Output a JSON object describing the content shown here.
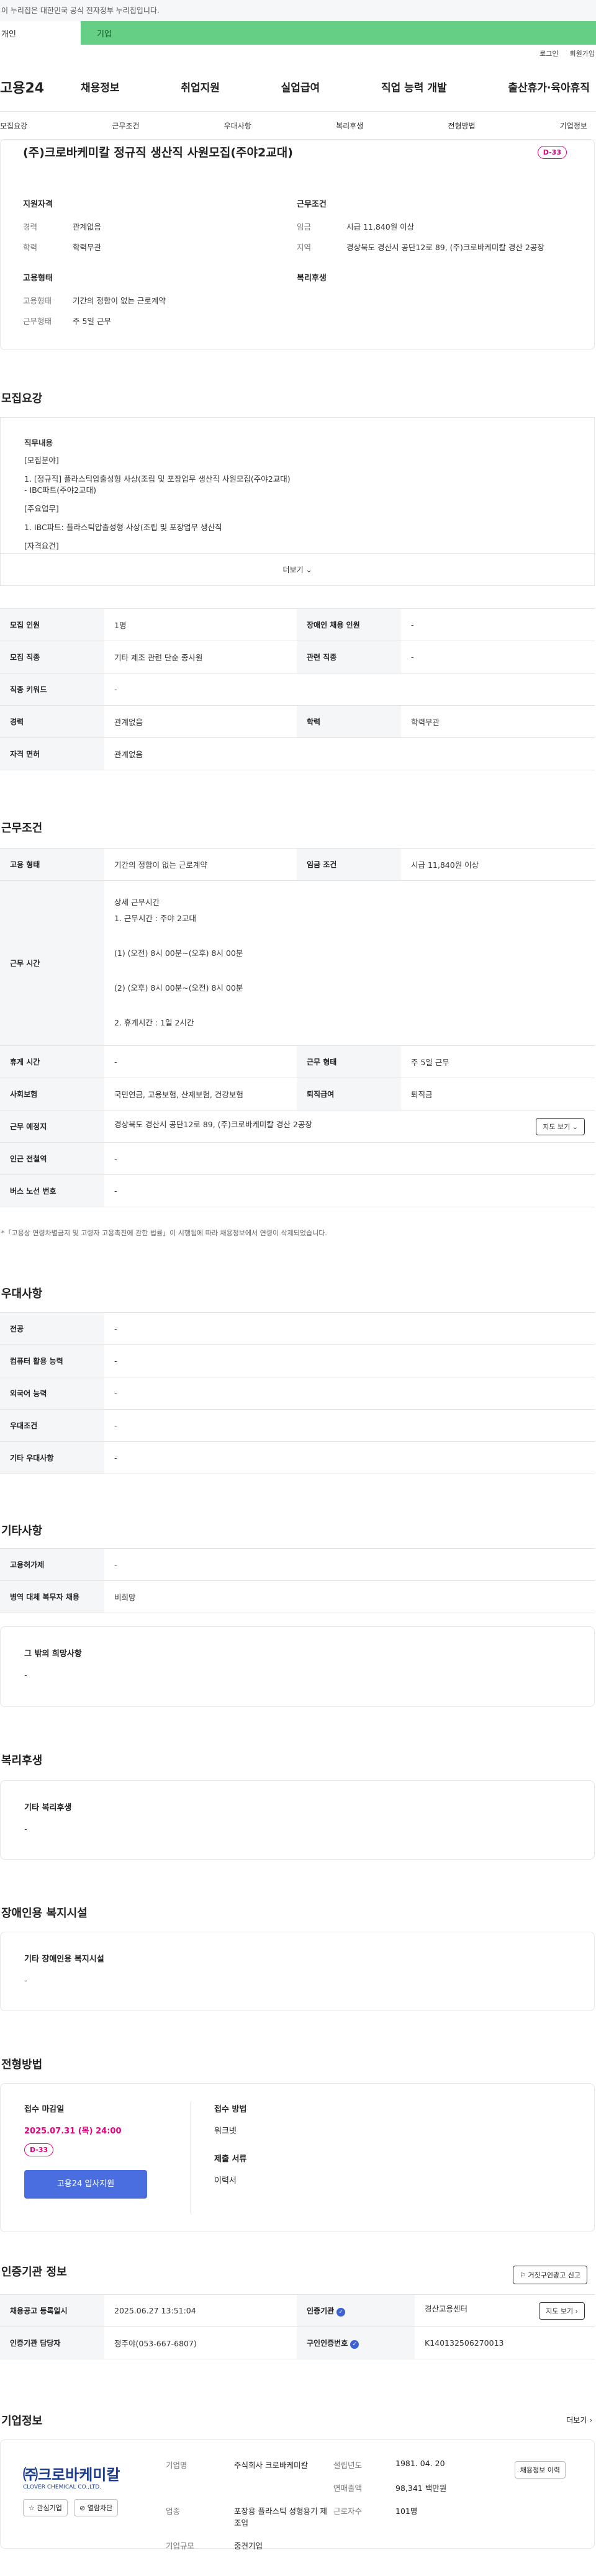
{
  "top_notice": "이 누리집은 대한민국 공식 전자정부 누리집입니다.",
  "tabs": {
    "personal": "개인",
    "company": "기업"
  },
  "util": {
    "login": "로그인",
    "join": "회원가입"
  },
  "gnb": {
    "logo": "고용24",
    "menu": [
      "채용정보",
      "취업지원",
      "실업급여",
      "직업 능력 개발",
      "출산휴가·육아휴직"
    ]
  },
  "anchors": [
    "모집요강",
    "근무조건",
    "우대사항",
    "복리후생",
    "전형방법",
    "기업정보"
  ],
  "summary": {
    "title": "(주)크로바케미칼 정규직 생산직 사원모집(주야2교대)",
    "dday": "D-33",
    "support": {
      "heading": "지원자격",
      "career_k": "경력",
      "career_v": "관계없음",
      "edu_k": "학력",
      "edu_v": "학력무관"
    },
    "conditions": {
      "heading": "근무조건",
      "wage_k": "임금",
      "wage_v": "시급 11,840원 이상",
      "area_k": "지역",
      "area_v": "경상북도 경산시 공단12로 89, (주)크로바케미칼 경산 2공장"
    },
    "employment": {
      "heading": "고용형태",
      "type_k": "고용형태",
      "type_v": "기간의 정함이 없는 근로계약",
      "shape_k": "근무형태",
      "shape_v": "주 5일 근무"
    },
    "welfare_heading": "복리후생"
  },
  "recruit": {
    "title": "모집요강",
    "detail_lines": [
      "직무내용",
      "[모집분야]",
      "1. [정규직] 플라스틱압출성형 사상(조립 및 포장업무 생산직 사원모집(주야2교대)",
      "- IBC파트(주야2교대)",
      "[주요업무]",
      "1. IBC파트: 플라스틱압출성형 사상(조립 및 포장업무 생산직",
      "[자격요건]"
    ],
    "more": "더보기",
    "rows": [
      {
        "k1": "모집 인원",
        "v1": "1명",
        "k2": "장애인 채용 인원",
        "v2": "-"
      },
      {
        "k1": "모집 직종",
        "v1": "기타 제조 관련 단순 종사원",
        "k2": "관련 직종",
        "v2": "-"
      },
      {
        "k1": "직종 키워드",
        "v1": "-"
      },
      {
        "k1": "경력",
        "v1": "관계없음",
        "k2": "학력",
        "v2": "학력무관"
      },
      {
        "k1": "자격 면허",
        "v1": "관계없음"
      }
    ]
  },
  "work": {
    "title": "근무조건",
    "employ_k": "고용 형태",
    "employ_v": "기간의 정함이 없는 근로계약",
    "wage_k": "임금 조건",
    "wage_v": "시급 11,840원 이상",
    "time_k": "근무 시간",
    "time_lines": [
      "상세 근무시간",
      "1. 근무시간 : 주야 2교대",
      "(1) (오전) 8시 00분~(오후) 8시 00분",
      "(2) (오후) 8시 00분~(오전) 8시 00분",
      "2. 휴게시간 : 1일 2시간"
    ],
    "rest_k": "휴게 시간",
    "rest_v": "-",
    "shape_k": "근무 형태",
    "shape_v": "주 5일 근무",
    "ins_k": "사회보험",
    "ins_v": "국민연금, 고용보험, 산재보험, 건강보험",
    "sev_k": "퇴직급여",
    "sev_v": "퇴직금",
    "place_k": "근무 예정지",
    "place_v": "경상북도 경산시 공단12로 89, (주)크로바케미칼 경산 2공장",
    "map_btn": "지도 보기",
    "subway_k": "인근 전철역",
    "subway_v": "-",
    "bus_k": "버스 노선 번호",
    "bus_v": "-",
    "note": "*「고용상 연령차별금지 및 고령자 고용촉진에 관한 법률」이 시행됨에 따라 채용정보에서 연령이 삭제되었습니다."
  },
  "preference": {
    "title": "우대사항",
    "rows": [
      {
        "k": "전공",
        "v": "-"
      },
      {
        "k": "컴퓨터 활용 능력",
        "v": "-"
      },
      {
        "k": "외국어 능력",
        "v": "-"
      },
      {
        "k": "우대조건",
        "v": "-"
      },
      {
        "k": "기타 우대사항",
        "v": "-"
      }
    ]
  },
  "etc": {
    "title": "기타사항",
    "rows": [
      {
        "k": "고용허가제",
        "v": "-"
      },
      {
        "k": "병역 대체 복무자 채용",
        "v": "비희망"
      }
    ],
    "wish_title": "그 밖의 희망사항",
    "wish_v": "-"
  },
  "welfare": {
    "title": "복리후생",
    "box_title": "기타 복리후생",
    "box_v": "-"
  },
  "disabled": {
    "title": "장애인용 복지시설",
    "box_title": "기타 장애인용 복지시설",
    "box_v": "-"
  },
  "selection": {
    "title": "전형방법",
    "deadline_k": "접수 마감일",
    "deadline_v": "2025.07.31 (목) 24:00",
    "dday": "D-33",
    "apply_btn": "고용24 입사지원",
    "method_k": "접수 방법",
    "method_v": "워크넷",
    "docs_k": "제출 서류",
    "docs_v": "이력서"
  },
  "cert": {
    "title": "인증기관 정보",
    "report_btn": "거짓구인광고 신고",
    "reg_k": "채용공고 등록일시",
    "reg_v": "2025.06.27 13:51:04",
    "org_k": "인증기관",
    "org_v": "경산고용센터",
    "map_btn": "지도 보기",
    "mgr_k": "인증기관 담당자",
    "mgr_v": "정주야(053-667-6807)",
    "num_k": "구인인증번호",
    "num_v": "K140132506270013"
  },
  "company": {
    "title": "기업정보",
    "more": "더보기",
    "logo_text": "㈜크로바케미칼",
    "logo_sub": "CLOVER CHEMICAL CO.,LTD.",
    "interest_btn": "관심기업",
    "block_btn": "열람차단",
    "name_k": "기업명",
    "name_v": "주식회사 크로바케미칼",
    "est_k": "설립년도",
    "est_v": "1981. 04. 20",
    "sales_k": "연매출액",
    "sales_v": "98,341 백만원",
    "ind_k": "업종",
    "ind_v": "포장용 플라스틱 성형용기 제조업",
    "emp_k": "근로자수",
    "emp_v": "101명",
    "size_k": "기업규모",
    "size_v": "중견기업",
    "jobs_btn": "채용정보 이력"
  }
}
